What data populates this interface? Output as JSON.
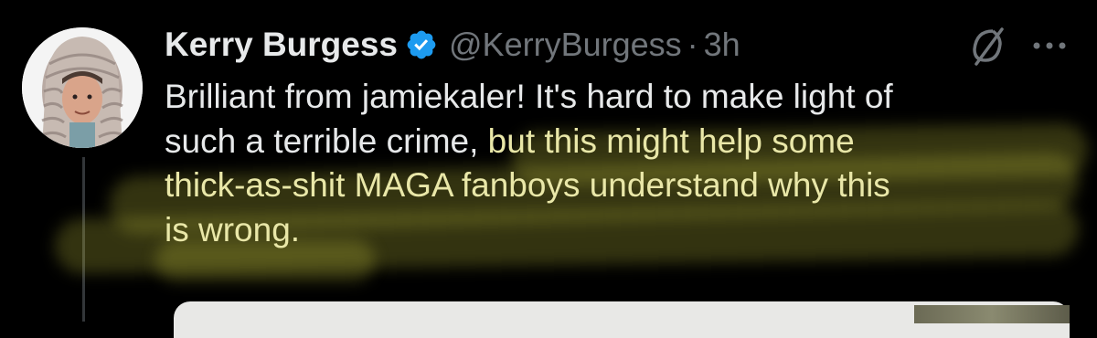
{
  "tweet": {
    "author_name": "Kerry Burgess",
    "handle": "@KerryBurgess",
    "separator": "·",
    "time": "3h",
    "text_lines": [
      {
        "before": "Brilliant from jamiekaler! It's hard to make light of",
        "highlight": ""
      },
      {
        "before": "such a terrible crime,",
        "highlight": " but this might help some"
      },
      {
        "before": "",
        "highlight": "thick-as-shit MAGA fanboys understand why this"
      },
      {
        "before": "",
        "highlight": "is wrong."
      }
    ]
  },
  "icons": {
    "verified": "verified-badge-icon",
    "grok": "grok-icon",
    "more": "more-options-icon"
  },
  "colors": {
    "background": "#000000",
    "text": "#e7e9ea",
    "muted": "#71767b",
    "verified": "#1d9bf0",
    "highlight": "#c4c43c"
  }
}
